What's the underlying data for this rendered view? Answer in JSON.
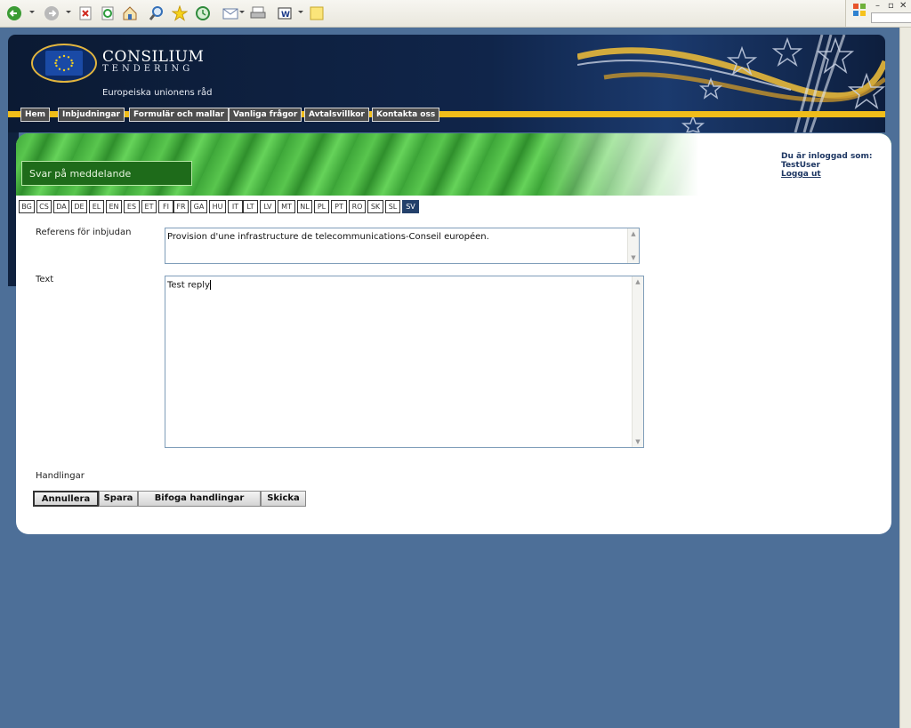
{
  "browser": {
    "toolbar_icons": [
      "back-arrow-icon",
      "forward-arrow-icon",
      "stop-icon",
      "refresh-icon",
      "home-icon",
      "search-icon",
      "favorites-star-icon",
      "history-icon",
      "mail-icon",
      "print-icon",
      "word-icon",
      "note-icon"
    ],
    "window_controls": [
      "minimize-icon",
      "restore-icon",
      "close-icon"
    ]
  },
  "header": {
    "brand_name": "CONSILIUM",
    "brand_sub": "TENDERING",
    "council_name": "Europeiska unionens råd",
    "nav": [
      "Hem",
      "Inbjudningar",
      "Formulär och mallar",
      "Vanliga frågor",
      "Avtalsvillkor",
      "Kontakta oss"
    ],
    "accent_color": "#f0bd1a"
  },
  "page": {
    "heading": "Svar på meddelande",
    "login_label": "Du är inloggad som:",
    "username": "TestUser",
    "logout": "Logga ut"
  },
  "languages": {
    "items": [
      "BG",
      "CS",
      "DA",
      "DE",
      "EL",
      "EN",
      "ES",
      "ET",
      "FI",
      "FR",
      "GA",
      "HU",
      "IT",
      "LT",
      "LV",
      "MT",
      "NL",
      "PL",
      "PT",
      "RO",
      "SK",
      "SL",
      "SV"
    ],
    "active": "SV"
  },
  "form": {
    "reference_label": "Referens för inbjudan",
    "reference_value": "Provision d'une infrastructure de telecommunications-Conseil européen.",
    "text_label": "Text",
    "text_value": "Test reply"
  },
  "actions": {
    "label": "Handlingar",
    "cancel": "Annullera",
    "save": "Spara",
    "attach": "Bifoga handlingar",
    "send": "Skicka"
  }
}
